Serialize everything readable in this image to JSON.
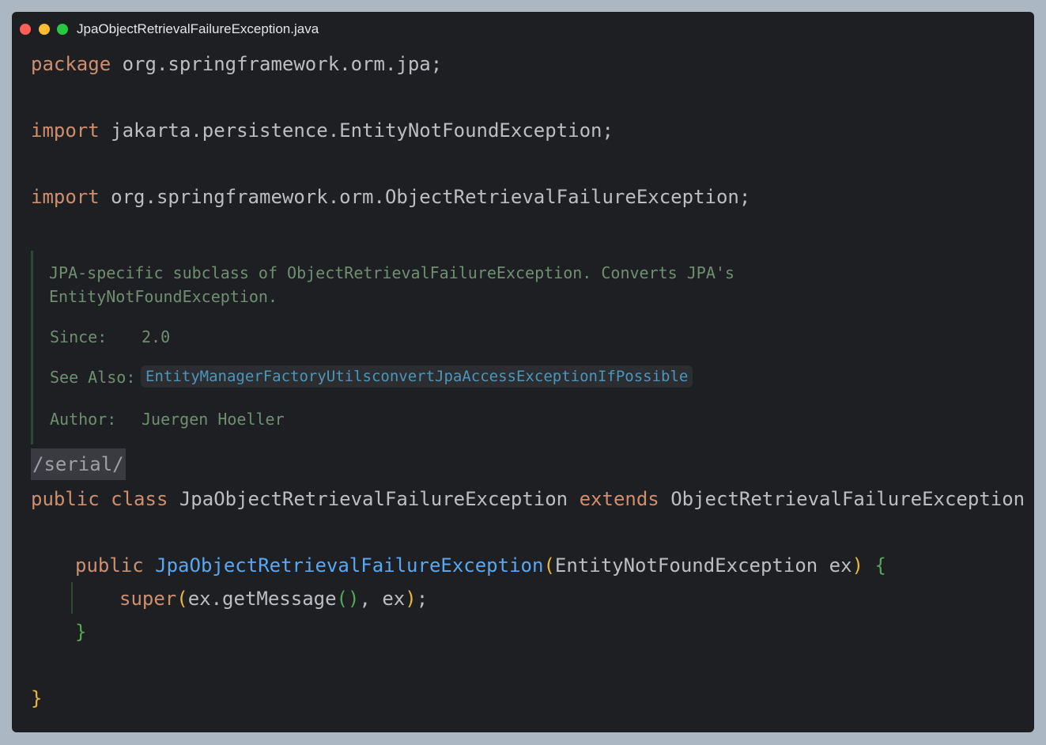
{
  "window": {
    "filename": "JpaObjectRetrievalFailureException.java"
  },
  "code": {
    "package_kw": "package",
    "package_name": "org.springframework.orm.jpa;",
    "import_kw": "import",
    "import1": "jakarta.persistence.EntityNotFoundException;",
    "import2": "org.springframework.orm.ObjectRetrievalFailureException;",
    "serial": "/serial/",
    "class_public": "public",
    "class_kw": "class",
    "class_name": "JpaObjectRetrievalFailureException",
    "extends_kw": "extends",
    "super_class": "ObjectRetrievalFailureException",
    "open_brace": "{",
    "ctor_public": "public",
    "ctor_name": "JpaObjectRetrievalFailureException",
    "paren_open": "(",
    "ctor_params": "EntityNotFoundException ex",
    "paren_close": ")",
    "ctor_brace_open": "{",
    "super_kw": "super",
    "super_paren_open": "(",
    "super_args_a": "ex.getMessage",
    "super_inner_parens": "()",
    "super_args_b": ", ex",
    "super_paren_close": ")",
    "semicolon": ";",
    "ctor_brace_close": "}",
    "close_brace": "}"
  },
  "doc": {
    "line1": "JPA-specific subclass of ObjectRetrievalFailureException. Converts JPA's",
    "line2": "EntityNotFoundException.",
    "since_label": "Since:",
    "since_value": "2.0",
    "see_also_label": "See Also:",
    "see_also_link": "EntityManagerFactoryUtilsconvertJpaAccessExceptionIfPossible",
    "author_label": "Author:",
    "author_value": "Juergen Hoeller"
  },
  "colors": {
    "background": "#1e1f22",
    "keyword": "#cf8e6d",
    "function": "#56a8f5",
    "bracket_yellow": "#e8ba36",
    "bracket_green": "#54a857",
    "doc_text": "#6f8f72",
    "link": "#4e96b9"
  }
}
